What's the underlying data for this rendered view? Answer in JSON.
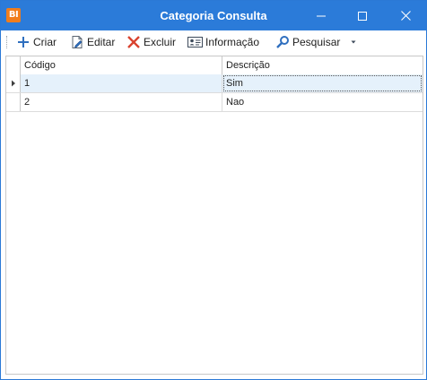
{
  "window": {
    "title": "Categoria Consulta",
    "app_icon_text": "BI",
    "accent": "#2b7bd9",
    "app_icon_color": "#f07d1c"
  },
  "toolbar": {
    "items": [
      {
        "label": "Criar",
        "icon": "plus-icon"
      },
      {
        "label": "Editar",
        "icon": "edit-document-icon"
      },
      {
        "label": "Excluir",
        "icon": "delete-x-icon"
      },
      {
        "label": "Informação",
        "icon": "info-card-icon"
      },
      {
        "label": "Pesquisar",
        "icon": "search-icon"
      }
    ],
    "overflow_icon": "dropdown-arrow-icon"
  },
  "grid": {
    "columns": [
      "Código",
      "Descrição"
    ],
    "rows": [
      {
        "codigo": "1",
        "descricao": "Sim",
        "selected": true
      },
      {
        "codigo": "2",
        "descricao": "Nao",
        "selected": false
      }
    ],
    "selection_color": "#e5f1fb"
  }
}
